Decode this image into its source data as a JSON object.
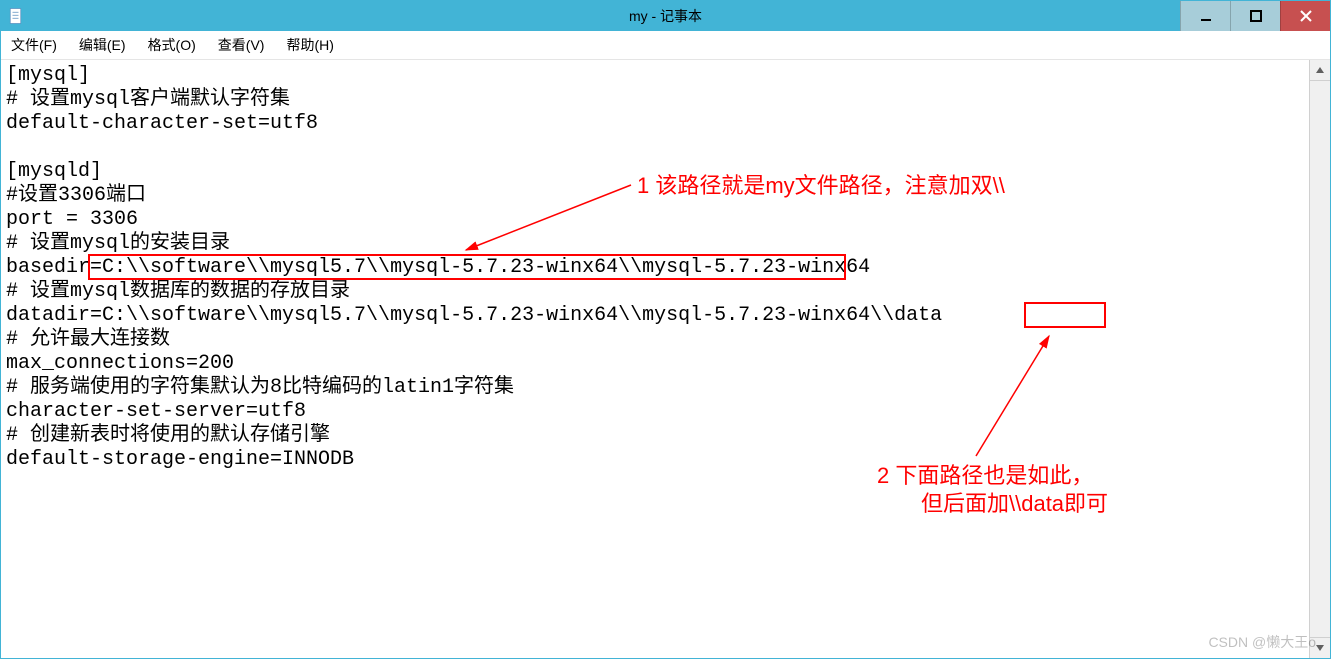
{
  "window": {
    "title": "my - 记事本"
  },
  "menubar": {
    "file": "文件(F)",
    "edit": "编辑(E)",
    "format": "格式(O)",
    "view": "查看(V)",
    "help": "帮助(H)"
  },
  "editor": {
    "lines": [
      "[mysql]",
      "# 设置mysql客户端默认字符集",
      "default-character-set=utf8",
      "",
      "[mysqld]",
      "#设置3306端口",
      "port = 3306",
      "# 设置mysql的安装目录",
      "basedir=C:\\\\software\\\\mysql5.7\\\\mysql-5.7.23-winx64\\\\mysql-5.7.23-winx64",
      "# 设置mysql数据库的数据的存放目录",
      "datadir=C:\\\\software\\\\mysql5.7\\\\mysql-5.7.23-winx64\\\\mysql-5.7.23-winx64\\\\data",
      "# 允许最大连接数",
      "max_connections=200",
      "# 服务端使用的字符集默认为8比特编码的latin1字符集",
      "character-set-server=utf8",
      "# 创建新表时将使用的默认存储引擎",
      "default-storage-engine=INNODB"
    ]
  },
  "annotations": {
    "note1": "1 该路径就是my文件路径，注意加双\\\\",
    "note2_line1": "2 下面路径也是如此，",
    "note2_line2": "但后面加\\\\data即可"
  },
  "watermark": "CSDN @懒大王o"
}
